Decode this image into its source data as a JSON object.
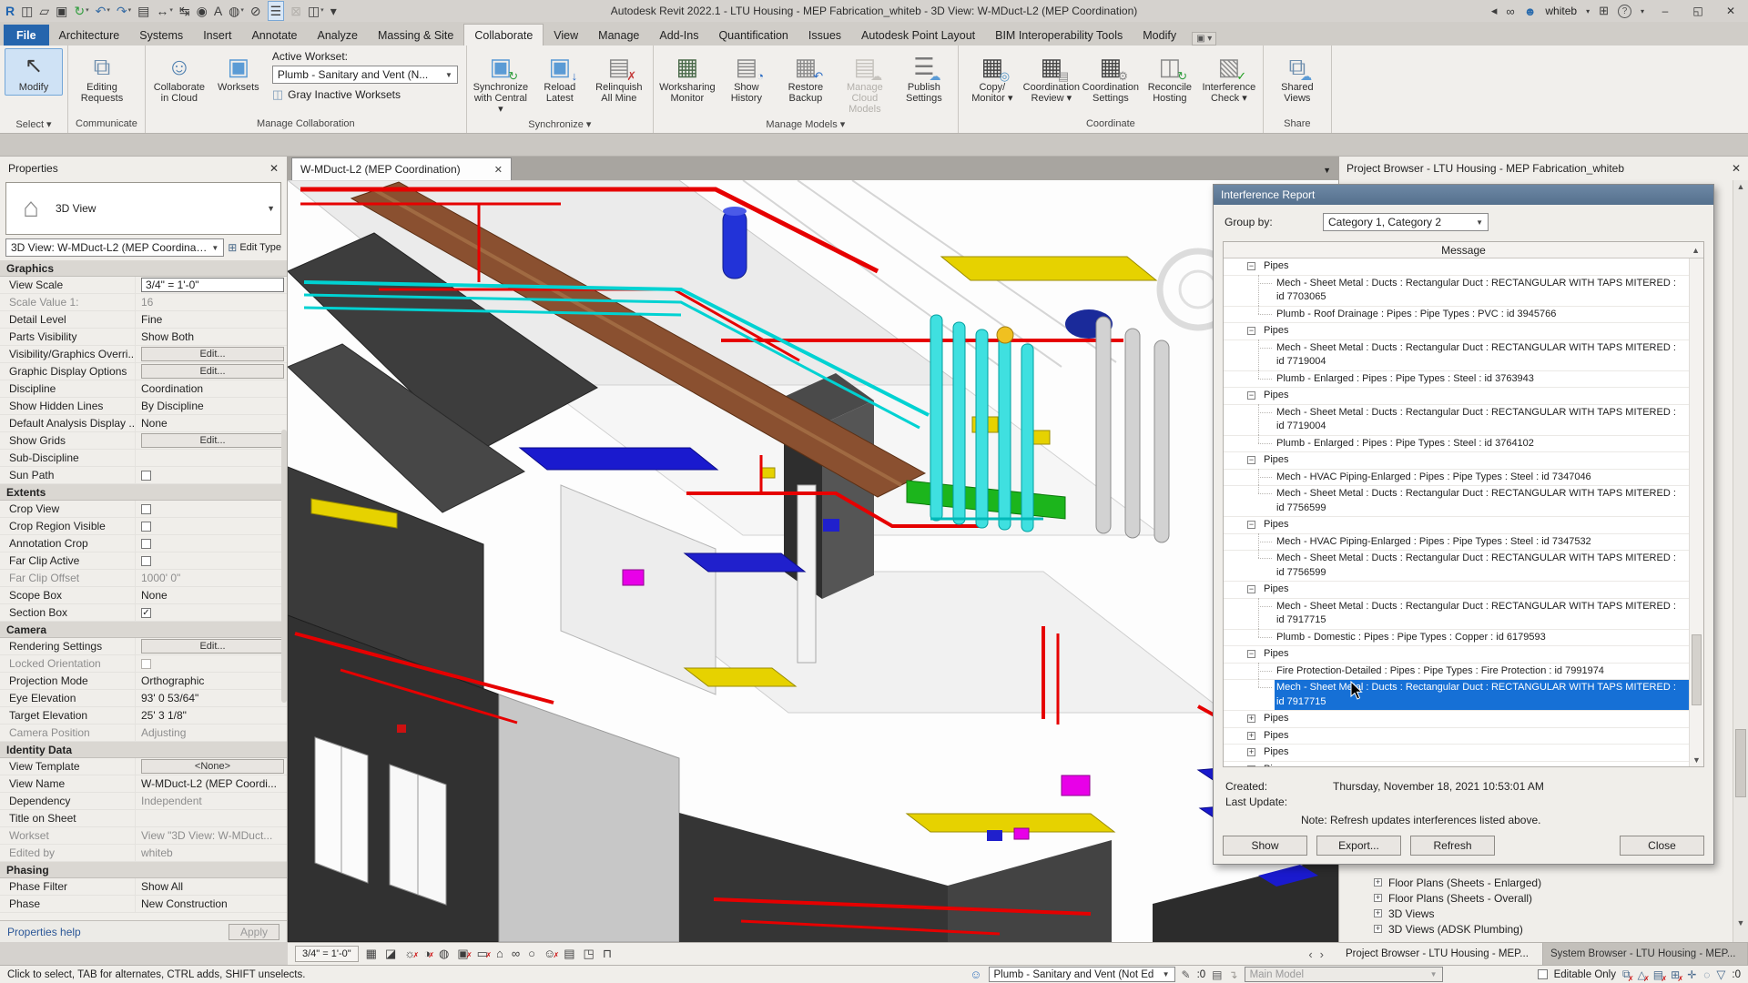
{
  "title_bar": {
    "title": "Autodesk Revit 2022.1 - LTU Housing - MEP Fabrication_whiteb - 3D View: W-MDuct-L2 (MEP Coordination)",
    "user": "whiteb",
    "qat": [
      {
        "name": "revit-app-icon",
        "glyph": "R",
        "color": "#1f64b0",
        "bold": true
      },
      {
        "name": "recent-documents-icon",
        "glyph": "◫"
      },
      {
        "name": "open-icon",
        "glyph": "▱"
      },
      {
        "name": "save-icon",
        "glyph": "▣"
      },
      {
        "name": "sync-with-central-icon",
        "glyph": "↻",
        "color": "#2e9c3c",
        "dd": true
      },
      {
        "name": "undo-icon",
        "glyph": "↶",
        "color": "#3a6ea5",
        "dd": true
      },
      {
        "name": "redo-icon",
        "glyph": "↷",
        "color": "#3a6ea5",
        "dd": true
      },
      {
        "name": "print-icon",
        "glyph": "▤"
      },
      {
        "name": "measure-icon",
        "glyph": "↔",
        "dd": true
      },
      {
        "name": "aligned-dimension-icon",
        "glyph": "↹"
      },
      {
        "name": "tag-icon",
        "glyph": "◉"
      },
      {
        "name": "text-icon",
        "glyph": "A"
      },
      {
        "name": "default-3d-view-icon",
        "glyph": "◍",
        "dd": true
      },
      {
        "name": "section-icon",
        "glyph": "⊘"
      },
      {
        "name": "thin-lines-icon",
        "glyph": "☰",
        "hl": true
      },
      {
        "name": "close-hidden-windows-icon",
        "glyph": "⊠",
        "disabled": true
      },
      {
        "name": "switch-windows-icon",
        "glyph": "◫",
        "dd": true
      },
      {
        "name": "customize-qat-icon",
        "glyph": "▾"
      }
    ],
    "window_buttons": {
      "minimize": "–",
      "restore": "◱",
      "close": "✕"
    }
  },
  "ribbon": {
    "tabs": [
      "File",
      "Architecture",
      "Systems",
      "Insert",
      "Annotate",
      "Analyze",
      "Massing & Site",
      "Collaborate",
      "View",
      "Manage",
      "Add-Ins",
      "Quantification",
      "Issues",
      "Autodesk Point Layout",
      "BIM Interoperability Tools",
      "Modify"
    ],
    "active_tab": "Collaborate",
    "panels": [
      {
        "label": "Select",
        "arrow": true,
        "buttons": [
          {
            "label": "Modify",
            "glyph": "↖",
            "color": "#3a3a3a",
            "selected": true
          }
        ]
      },
      {
        "label": "Communicate",
        "buttons": [
          {
            "label": "Editing Requests",
            "glyph": "⧉",
            "color": "#6f8fae"
          }
        ]
      },
      {
        "label": "Manage Collaboration",
        "buttons": [
          {
            "label": "Collaborate in Cloud",
            "glyph": "☺",
            "color": "#4f80b0"
          },
          {
            "label": "Worksets",
            "glyph": "▣",
            "color": "#5b9bd5"
          }
        ],
        "extra": {
          "active_workset_label": "Active Workset:",
          "active_workset_value": "Plumb - Sanitary and Vent (N...",
          "gray_inactive_label": "Gray Inactive Worksets"
        }
      },
      {
        "label": "Synchronize",
        "arrow": true,
        "buttons": [
          {
            "label": "Synchronize with Central",
            "glyph": "▣",
            "color": "#5b9bd5",
            "badge": "↻",
            "bcolor": "#2e9c3c",
            "mini_arrow": true
          },
          {
            "label": "Reload Latest",
            "glyph": "▣",
            "color": "#5b9bd5",
            "badge": "↓",
            "bcolor": "#2b6cc4"
          },
          {
            "label": "Relinquish All Mine",
            "glyph": "▤",
            "color": "#8a8a8a",
            "badge": "✗",
            "bcolor": "#c43b3b"
          }
        ]
      },
      {
        "label": "Manage Models",
        "arrow": true,
        "buttons": [
          {
            "label": "Worksharing Monitor",
            "glyph": "▦",
            "color": "#4a6a4a"
          },
          {
            "label": "Show History",
            "glyph": "▤",
            "color": "#8a8a8a",
            "badge": "◔",
            "bcolor": "#2b6cc4"
          },
          {
            "label": "Restore Backup",
            "glyph": "▦",
            "color": "#8a8a8a",
            "badge": "↶",
            "bcolor": "#2b6cc4"
          },
          {
            "label": "Manage Cloud Models",
            "glyph": "▤",
            "color": "#c6c3be",
            "badge": "☁",
            "bcolor": "#c6c3be",
            "disabled": true
          },
          {
            "label": "Publish Settings",
            "glyph": "☰",
            "color": "#7a7a7a",
            "badge": "☁",
            "bcolor": "#5b9bd5"
          }
        ]
      },
      {
        "label": "Coordinate",
        "buttons": [
          {
            "label": "Copy/ Monitor",
            "glyph": "▦",
            "color": "#454545",
            "badge": "◎",
            "bcolor": "#4a90c4",
            "mini_arrow": true
          },
          {
            "label": "Coordination Review",
            "glyph": "▦",
            "color": "#454545",
            "badge": "▤",
            "bcolor": "#8a8a8a",
            "mini_arrow": true
          },
          {
            "label": "Coordination Settings",
            "glyph": "▦",
            "color": "#454545",
            "badge": "⚙",
            "bcolor": "#8a8a8a"
          },
          {
            "label": "Reconcile Hosting",
            "glyph": "◫",
            "color": "#8a8a8a",
            "badge": "↻",
            "bcolor": "#2e9c3c"
          },
          {
            "label": "Interference Check",
            "glyph": "▧",
            "color": "#8a8a8a",
            "badge": "✓",
            "bcolor": "#1a9c1a",
            "mini_arrow": true
          }
        ]
      },
      {
        "label": "Share",
        "buttons": [
          {
            "label": "Shared Views",
            "glyph": "⧉",
            "color": "#6f8fae",
            "badge": "☁",
            "bcolor": "#5b9bd5"
          }
        ]
      }
    ]
  },
  "properties": {
    "header": "Properties",
    "type_label": "3D View",
    "instance": "3D View: W-MDuct-L2 (MEP Coordination)",
    "edit_type_label": "Edit Type",
    "sections": [
      {
        "name": "Graphics",
        "rows": [
          {
            "l": "View Scale",
            "v": "3/4\" = 1'-0\"",
            "k": "box"
          },
          {
            "l": "Scale Value    1:",
            "v": "16",
            "k": "g",
            "gl": true
          },
          {
            "l": "Detail Level",
            "v": "Fine",
            "k": "t"
          },
          {
            "l": "Parts Visibility",
            "v": "Show Both",
            "k": "t"
          },
          {
            "l": "Visibility/Graphics Overri...",
            "v": "Edit...",
            "k": "b"
          },
          {
            "l": "Graphic Display Options",
            "v": "Edit...",
            "k": "b"
          },
          {
            "l": "Discipline",
            "v": "Coordination",
            "k": "t"
          },
          {
            "l": "Show Hidden Lines",
            "v": "By Discipline",
            "k": "t"
          },
          {
            "l": "Default Analysis Display ...",
            "v": "None",
            "k": "t"
          },
          {
            "l": "Show Grids",
            "v": "Edit...",
            "k": "b"
          },
          {
            "l": "Sub-Discipline",
            "v": "",
            "k": "t"
          },
          {
            "l": "Sun Path",
            "v": "",
            "k": "c"
          }
        ]
      },
      {
        "name": "Extents",
        "rows": [
          {
            "l": "Crop View",
            "v": "",
            "k": "c"
          },
          {
            "l": "Crop Region Visible",
            "v": "",
            "k": "c"
          },
          {
            "l": "Annotation Crop",
            "v": "",
            "k": "c"
          },
          {
            "l": "Far Clip Active",
            "v": "",
            "k": "c"
          },
          {
            "l": "Far Clip Offset",
            "v": "1000'  0\"",
            "k": "g",
            "gl": true
          },
          {
            "l": "Scope Box",
            "v": "None",
            "k": "t"
          },
          {
            "l": "Section Box",
            "v": "",
            "k": "cc"
          }
        ]
      },
      {
        "name": "Camera",
        "rows": [
          {
            "l": "Rendering Settings",
            "v": "Edit...",
            "k": "b"
          },
          {
            "l": "Locked Orientation",
            "v": "",
            "k": "cg",
            "gl": true
          },
          {
            "l": "Projection Mode",
            "v": "Orthographic",
            "k": "t"
          },
          {
            "l": "Eye Elevation",
            "v": "93'  0 53/64\"",
            "k": "t"
          },
          {
            "l": "Target Elevation",
            "v": "25'  3 1/8\"",
            "k": "t"
          },
          {
            "l": "Camera Position",
            "v": "Adjusting",
            "k": "g",
            "gl": true
          }
        ]
      },
      {
        "name": "Identity Data",
        "rows": [
          {
            "l": "View Template",
            "v": "<None>",
            "k": "b"
          },
          {
            "l": "View Name",
            "v": "W-MDuct-L2 (MEP Coordi...",
            "k": "t"
          },
          {
            "l": "Dependency",
            "v": "Independent",
            "k": "g"
          },
          {
            "l": "Title on Sheet",
            "v": "",
            "k": "t"
          },
          {
            "l": "Workset",
            "v": "View \"3D View: W-MDuct...",
            "k": "g",
            "gl": true
          },
          {
            "l": "Edited by",
            "v": "whiteb",
            "k": "g",
            "gl": true
          }
        ]
      },
      {
        "name": "Phasing",
        "rows": [
          {
            "l": "Phase Filter",
            "v": "Show All",
            "k": "t"
          },
          {
            "l": "Phase",
            "v": "New Construction",
            "k": "t"
          }
        ]
      }
    ],
    "help_link": "Properties help",
    "apply_label": "Apply"
  },
  "viewport": {
    "tab": "W-MDuct-L2 (MEP Coordination)",
    "scale": "3/4\" = 1'-0\"",
    "view_control_icons": [
      {
        "name": "show-crop-icon",
        "g": "▦"
      },
      {
        "name": "visual-style-icon",
        "g": "◪"
      },
      {
        "name": "sun-path-off-icon",
        "g": "☼",
        "x": true
      },
      {
        "name": "shadows-off-icon",
        "g": "◑",
        "x": true
      },
      {
        "name": "rendering-dialog-icon",
        "g": "◍"
      },
      {
        "name": "crop-view-off-icon",
        "g": "▣",
        "x": true
      },
      {
        "name": "crop-region-off-icon",
        "g": "▭",
        "x": true
      },
      {
        "name": "lock-3d-view-icon",
        "g": "⌂"
      },
      {
        "name": "temporary-hide-isolate-icon",
        "g": "∞"
      },
      {
        "name": "reveal-hidden-icon",
        "g": "○"
      },
      {
        "name": "worksharing-display-off-icon",
        "g": "☺",
        "x": true
      },
      {
        "name": "temporary-view-properties-icon",
        "g": "▤"
      },
      {
        "name": "displaced-elements-icon",
        "g": "◳"
      },
      {
        "name": "reveal-constraints-icon",
        "g": "⊓"
      }
    ]
  },
  "interference": {
    "title": "Interference Report",
    "group_by_label": "Group by:",
    "group_by_value": "Category 1, Category 2",
    "column_header": "Message",
    "groups": [
      {
        "label": "Pipes",
        "expanded": true,
        "items": [
          {
            "text": "Mech - Sheet Metal : Ducts : Rectangular Duct : RECTANGULAR WITH TAPS MITERED : id 7703065"
          },
          {
            "text": "Plumb - Roof Drainage : Pipes : Pipe Types : PVC : id 3945766"
          }
        ]
      },
      {
        "label": "Pipes",
        "expanded": true,
        "items": [
          {
            "text": "Mech - Sheet Metal : Ducts : Rectangular Duct : RECTANGULAR WITH TAPS MITERED : id 7719004"
          },
          {
            "text": "Plumb - Enlarged : Pipes : Pipe Types : Steel : id 3763943"
          }
        ]
      },
      {
        "label": "Pipes",
        "expanded": true,
        "items": [
          {
            "text": "Mech - Sheet Metal : Ducts : Rectangular Duct : RECTANGULAR WITH TAPS MITERED : id 7719004"
          },
          {
            "text": "Plumb - Enlarged : Pipes : Pipe Types : Steel : id 3764102"
          }
        ]
      },
      {
        "label": "Pipes",
        "expanded": true,
        "items": [
          {
            "text": "Mech - HVAC Piping-Enlarged : Pipes : Pipe Types : Steel : id 7347046"
          },
          {
            "text": "Mech - Sheet Metal : Ducts : Rectangular Duct : RECTANGULAR WITH TAPS MITERED : id 7756599"
          }
        ]
      },
      {
        "label": "Pipes",
        "expanded": true,
        "items": [
          {
            "text": "Mech - HVAC Piping-Enlarged : Pipes : Pipe Types : Steel : id 7347532"
          },
          {
            "text": "Mech - Sheet Metal : Ducts : Rectangular Duct : RECTANGULAR WITH TAPS MITERED : id 7756599"
          }
        ]
      },
      {
        "label": "Pipes",
        "expanded": true,
        "items": [
          {
            "text": "Mech - Sheet Metal : Ducts : Rectangular Duct : RECTANGULAR WITH TAPS MITERED : id 7917715"
          },
          {
            "text": "Plumb - Domestic : Pipes : Pipe Types : Copper : id 6179593"
          }
        ]
      },
      {
        "label": "Pipes",
        "expanded": true,
        "items": [
          {
            "text": "Fire Protection-Detailed : Pipes : Pipe Types : Fire Protection : id 7991974"
          },
          {
            "text": "Mech - Sheet Metal : Ducts : Rectangular Duct : RECTANGULAR WITH TAPS MITERED : id 7917715",
            "selected": true
          }
        ]
      },
      {
        "label": "Pipes",
        "expanded": false
      },
      {
        "label": "Pipes",
        "expanded": false
      },
      {
        "label": "Pipes",
        "expanded": false
      },
      {
        "label": "Pipes",
        "expanded": false
      }
    ],
    "created_label": "Created:",
    "created_value": "Thursday, November 18, 2021 10:53:01 AM",
    "last_update_label": "Last Update:",
    "note": "Note: Refresh updates interferences listed above.",
    "buttons": {
      "show": "Show",
      "export": "Export...",
      "refresh": "Refresh",
      "close": "Close"
    }
  },
  "project_browser": {
    "title": "Project Browser - LTU Housing - MEP Fabrication_whiteb",
    "items": [
      "Floor Plans (Sheets - Enlarged)",
      "Floor Plans (Sheets - Overall)",
      "3D Views",
      "3D Views (ADSK Plumbing)"
    ],
    "tabs": [
      "Project Browser - LTU Housing - MEP...",
      "System Browser - LTU Housing - MEP..."
    ]
  },
  "status_bar": {
    "hint": "Click to select, TAB for alternates, CTRL adds, SHIFT unselects.",
    "workset_value": "Plumb - Sanitary and Vent (Not Ed",
    "requests_count": ":0",
    "main_model": "Main Model",
    "editable_only_label": "Editable Only",
    "filter_count": ":0",
    "exclude_icons": [
      {
        "name": "exclude-links-icon",
        "g": "⧉",
        "x": true
      },
      {
        "name": "exclude-underlay-icon",
        "g": "△",
        "x": true
      },
      {
        "name": "exclude-pinned-icon",
        "g": "▤",
        "x": true
      },
      {
        "name": "exclude-imports-icon",
        "g": "⊞",
        "x": true
      },
      {
        "name": "drag-on-selection-icon",
        "g": "✛"
      },
      {
        "name": "press-drag-icon",
        "g": "◌"
      }
    ]
  }
}
